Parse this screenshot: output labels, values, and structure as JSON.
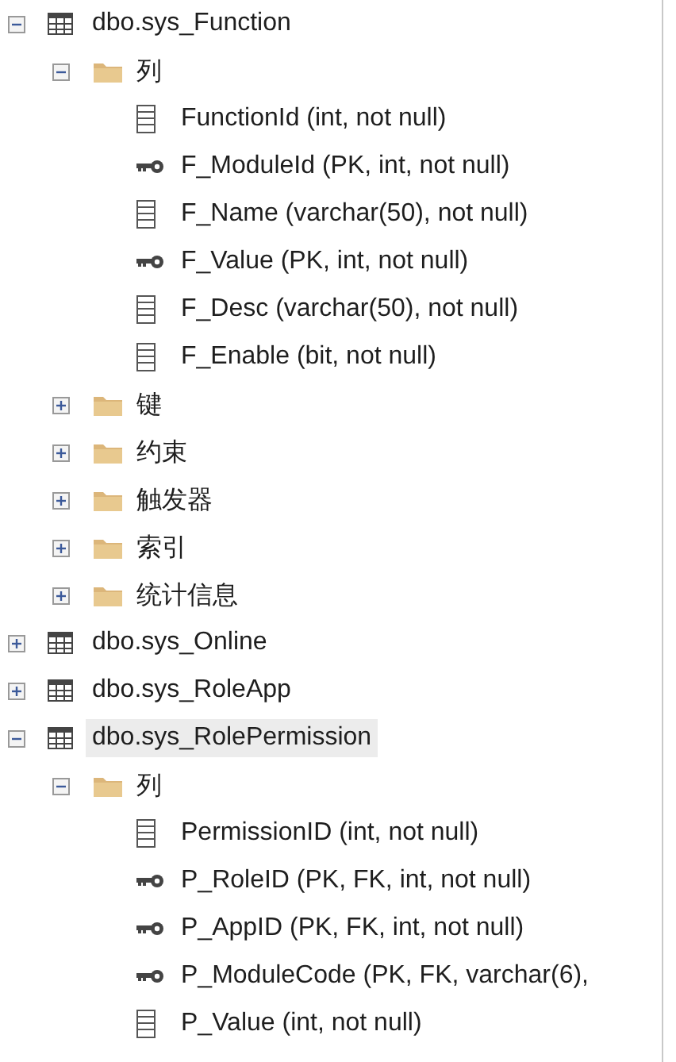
{
  "tree": [
    {
      "label": "dbo.sys_Function",
      "kind": "table",
      "expanded": true,
      "selected": false,
      "children": [
        {
          "label": "列",
          "kind": "folder",
          "expanded": true,
          "children": [
            {
              "label": "FunctionId (int, not null)",
              "kind": "column"
            },
            {
              "label": "F_ModuleId (PK, int, not null)",
              "kind": "key"
            },
            {
              "label": "F_Name (varchar(50), not null)",
              "kind": "column"
            },
            {
              "label": "F_Value (PK, int, not null)",
              "kind": "key"
            },
            {
              "label": "F_Desc (varchar(50), not null)",
              "kind": "column"
            },
            {
              "label": "F_Enable (bit, not null)",
              "kind": "column"
            }
          ]
        },
        {
          "label": "键",
          "kind": "folder",
          "expanded": false
        },
        {
          "label": "约束",
          "kind": "folder",
          "expanded": false
        },
        {
          "label": "触发器",
          "kind": "folder",
          "expanded": false
        },
        {
          "label": "索引",
          "kind": "folder",
          "expanded": false
        },
        {
          "label": "统计信息",
          "kind": "folder",
          "expanded": false
        }
      ]
    },
    {
      "label": "dbo.sys_Online",
      "kind": "table",
      "expanded": false,
      "selected": false
    },
    {
      "label": "dbo.sys_RoleApp",
      "kind": "table",
      "expanded": false,
      "selected": false
    },
    {
      "label": "dbo.sys_RolePermission",
      "kind": "table",
      "expanded": true,
      "selected": true,
      "children": [
        {
          "label": "列",
          "kind": "folder",
          "expanded": true,
          "children": [
            {
              "label": "PermissionID (int, not null)",
              "kind": "column"
            },
            {
              "label": "P_RoleID (PK, FK, int, not null)",
              "kind": "key"
            },
            {
              "label": "P_AppID (PK, FK, int, not null)",
              "kind": "key"
            },
            {
              "label": "P_ModuleCode (PK, FK, varchar(6),",
              "kind": "key"
            },
            {
              "label": "P_Value (int, not null)",
              "kind": "column"
            }
          ]
        }
      ]
    }
  ]
}
